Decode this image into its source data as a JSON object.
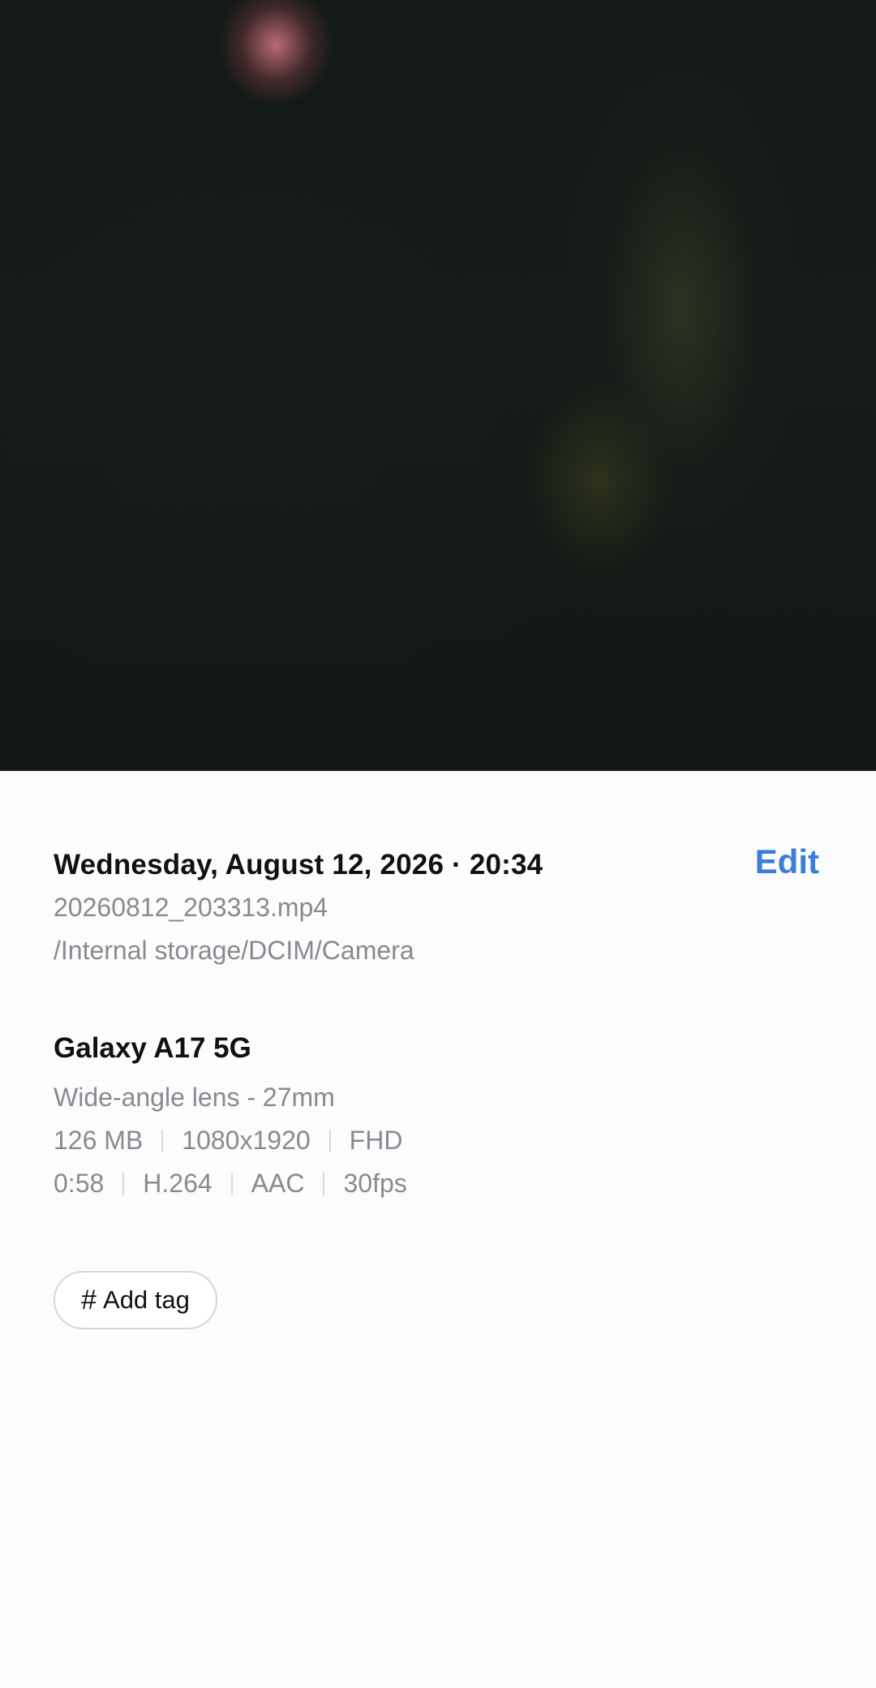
{
  "preview": {
    "alt": "video preview"
  },
  "details": {
    "date_time": "Wednesday, August 12, 2026 · 20:34",
    "edit_label": "Edit",
    "file_name": "20260812_203313.mp4",
    "file_path": "/Internal storage/DCIM/Camera",
    "device": {
      "name": "Galaxy A17 5G",
      "lens": "Wide-angle lens - 27mm",
      "file_info": [
        "126 MB",
        "1080x1920",
        "FHD"
      ],
      "video_info": [
        "0:58",
        "H.264",
        "AAC",
        "30fps"
      ]
    },
    "tag": {
      "icon": "hash-icon",
      "label": "Add tag"
    }
  },
  "colors": {
    "accent": "#3a7fd5",
    "background": "#fcfcfe",
    "primary_text": "#111111",
    "secondary_text": "#8a8a8e"
  }
}
